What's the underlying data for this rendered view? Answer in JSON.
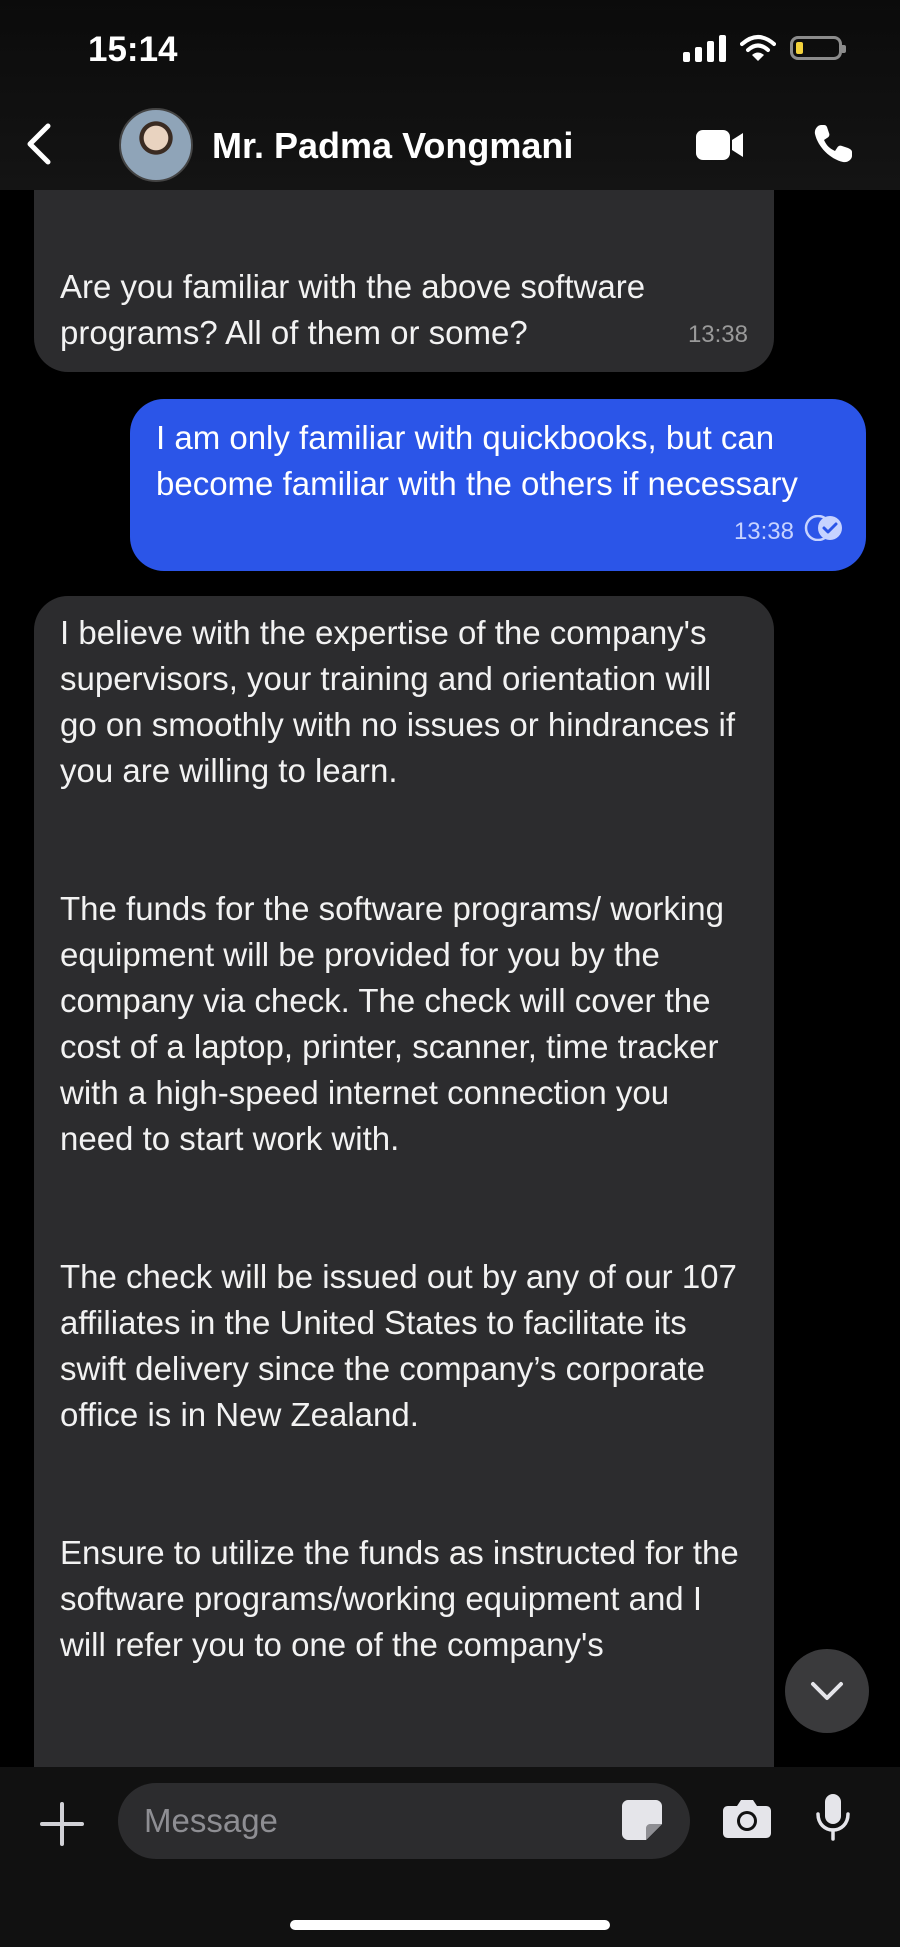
{
  "status_bar": {
    "time": "15:14"
  },
  "header": {
    "contact_name": "Mr. Padma Vongmani"
  },
  "messages": [
    {
      "direction": "incoming",
      "text": "Are you familiar with the above software programs? All of them or some?",
      "time": "13:38"
    },
    {
      "direction": "outgoing",
      "text": "I am only familiar with quickbooks, but can become familiar with the others if necessary",
      "time": "13:38"
    },
    {
      "direction": "incoming",
      "paragraphs": [
        "I believe with the expertise of the company's supervisors, your training and orientation will go on smoothly with no issues or hindrances if you are willing to learn.",
        "The funds for the software programs/ working equipment will be provided for you by the company via check. The check will cover the cost of a laptop, printer, scanner, time tracker with a high-speed internet connection you need to start work with.",
        "The check will be issued out by any of our 107 affiliates in the United States to facilitate its swift delivery since the company’s corporate office is in New Zealand.",
        "Ensure to utilize the funds as instructed for the software programs/working equipment and I will refer you to one of the company's"
      ]
    }
  ],
  "composer": {
    "placeholder": "Message"
  },
  "colors": {
    "outgoing_bubble": "#2b55e8",
    "incoming_bubble": "#2c2c2e",
    "background": "#000000"
  },
  "icons": [
    "back-chevron-icon",
    "video-call-icon",
    "phone-icon",
    "plus-icon",
    "sticker-icon",
    "camera-icon",
    "microphone-icon",
    "chevron-down-icon",
    "signal-icon",
    "wifi-icon",
    "battery-icon"
  ]
}
